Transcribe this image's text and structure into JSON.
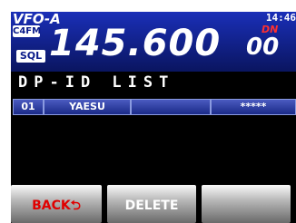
{
  "header": {
    "vfo": "VFO-A",
    "mode": "C4FM",
    "time": "14:46",
    "sql": "SQL",
    "frequency_main": "145.600",
    "frequency_sub": "00",
    "dn": "DN"
  },
  "list": {
    "title": "DP-ID LIST",
    "rows": [
      {
        "index": "01",
        "name": "YAESU",
        "col3": "",
        "password": "*****"
      }
    ]
  },
  "softkeys": {
    "back": "BACK",
    "back_icon": "return-arrow-icon",
    "delete": "DELETE",
    "third": ""
  },
  "colors": {
    "header_top": "#1a2fb8",
    "header_bottom": "#0a1560",
    "back_label": "#e00000",
    "dn": "#ff3030"
  }
}
